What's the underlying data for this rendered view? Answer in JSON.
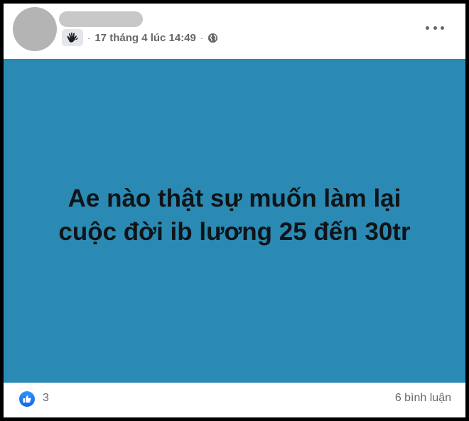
{
  "post": {
    "timestamp": "17 tháng 4 lúc 14:49",
    "separator": "·",
    "text_line_1": "Ae nào thật sự muốn làm lại",
    "text_line_2": "cuộc đời ib lương 25 đến 30tr",
    "image_background_color": "#2b8ab3"
  },
  "reactions": {
    "like_count": "3",
    "comments_label": "6 bình luận"
  },
  "icons": {
    "group": "hand-group-icon",
    "privacy": "globe-icon",
    "more": "more-options-icon",
    "like": "like-icon"
  }
}
